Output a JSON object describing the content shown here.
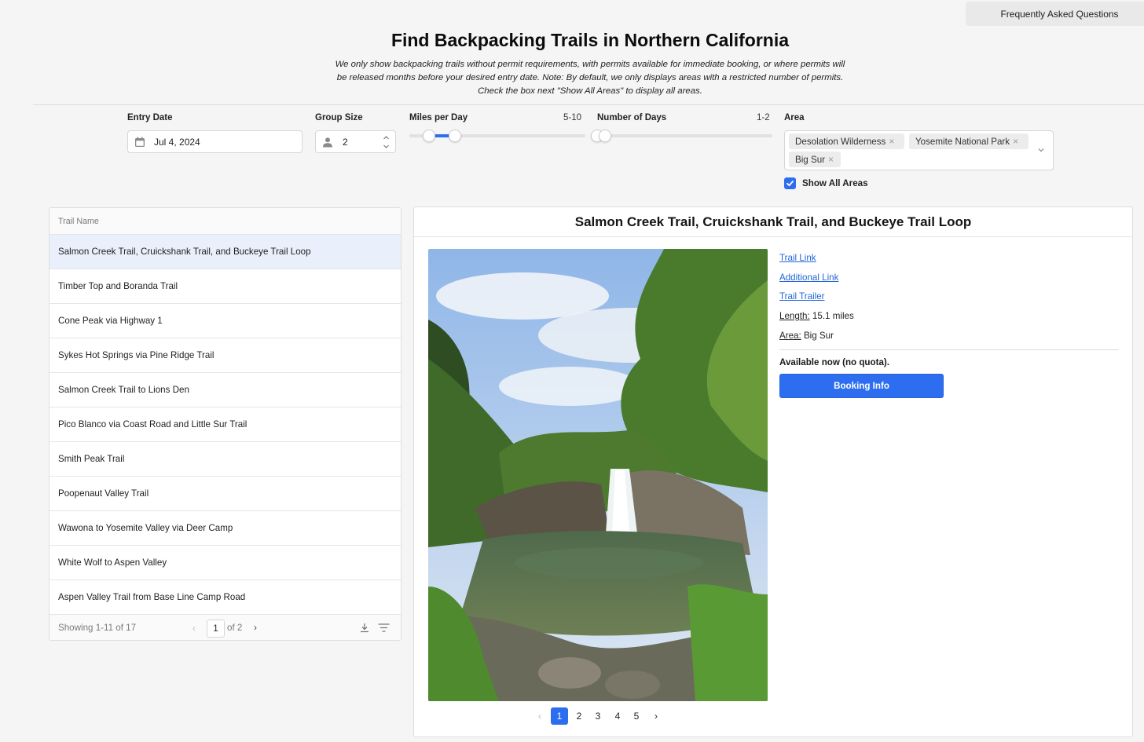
{
  "header": {
    "faq_label": "Frequently Asked Questions",
    "title": "Find Backpacking Trails in Northern California",
    "subtitle_lines": [
      "We only show backpacking trails without permit requirements, with permits available for immediate booking, or where permits will",
      "be released months before your desired entry date. Note: By default, we only displays areas with a restricted number of permits.",
      "Check the box next \"Show All Areas\" to display all areas."
    ]
  },
  "filters": {
    "entry_date": {
      "label": "Entry Date",
      "value": "Jul 4, 2024"
    },
    "group_size": {
      "label": "Group Size",
      "value": "2"
    },
    "miles_per_day": {
      "label": "Miles per Day",
      "range_text": "5-10",
      "min": 5,
      "max": 10
    },
    "number_of_days": {
      "label": "Number of Days",
      "range_text": "1-2",
      "min": 1,
      "max": 2
    },
    "area": {
      "label": "Area",
      "selected": [
        "Desolation Wilderness",
        "Yosemite National Park",
        "Big Sur"
      ]
    },
    "show_all_areas": {
      "label": "Show All Areas",
      "checked": true
    }
  },
  "trail_table": {
    "column_header": "Trail Name",
    "rows": [
      "Salmon Creek Trail, Cruickshank Trail, and Buckeye Trail Loop",
      "Timber Top and Boranda Trail",
      "Cone Peak via Highway 1",
      "Sykes Hot Springs via Pine Ridge Trail",
      "Salmon Creek Trail to Lions Den",
      "Pico Blanco via Coast Road and Little Sur Trail",
      "Smith Peak Trail",
      "Poopenaut Valley Trail",
      "Wawona to Yosemite Valley via Deer Camp",
      "White Wolf to Aspen Valley",
      "Aspen Valley Trail from Base Line Camp Road"
    ],
    "selected_index": 0,
    "footer": {
      "showing": "Showing 1-11 of 17",
      "current_page": "1",
      "of_pages": "of 2"
    }
  },
  "detail": {
    "title": "Salmon Creek Trail, Cruickshank Trail, and Buckeye Trail Loop",
    "links": {
      "trail_link": "Trail Link",
      "additional_link": "Additional Link",
      "trail_trailer": "Trail Trailer"
    },
    "length_label": "Length:",
    "length_value": "15.1 miles",
    "area_label": "Area:",
    "area_value": "Big Sur",
    "availability": "Available now (no quota).",
    "booking_label": "Booking Info",
    "photo_pages": [
      "1",
      "2",
      "3",
      "4",
      "5"
    ],
    "photo_current_page": 1
  },
  "colors": {
    "accent": "#2d6ef1",
    "link": "#2166d7",
    "selected_row": "#e9f0fb"
  }
}
